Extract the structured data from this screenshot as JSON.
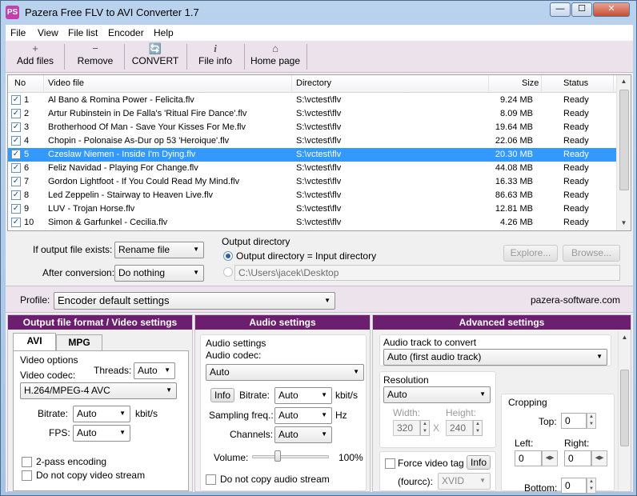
{
  "window": {
    "title": "Pazera Free FLV to AVI Converter 1.7",
    "app_icon": "PS",
    "controls": {
      "minimize": "—",
      "maximize": "☐",
      "close": "✕"
    }
  },
  "menu": [
    "File",
    "View",
    "File list",
    "Encoder",
    "Help"
  ],
  "toolbar": {
    "add": {
      "label": "Add files",
      "icon": "plus-icon",
      "glyph": "+"
    },
    "remove": {
      "label": "Remove",
      "icon": "minus-icon",
      "glyph": "−"
    },
    "convert": {
      "label": "CONVERT",
      "icon": "convert-icon",
      "glyph": "🔄"
    },
    "fileinfo": {
      "label": "File info",
      "icon": "info-icon",
      "glyph": "i"
    },
    "home": {
      "label": "Home page",
      "icon": "home-icon",
      "glyph": "⌂"
    }
  },
  "file_list": {
    "columns": [
      "No",
      "Video file",
      "Directory",
      "Size",
      "Status"
    ],
    "rows": [
      {
        "no": "1",
        "file": "Al Bano & Romina Power - Felicita.flv",
        "dir": "S:\\vctest\\flv",
        "size": "9.24 MB",
        "status": "Ready"
      },
      {
        "no": "2",
        "file": "Artur Rubinstein in De Falla's 'Ritual Fire Dance'.flv",
        "dir": "S:\\vctest\\flv",
        "size": "8.09 MB",
        "status": "Ready"
      },
      {
        "no": "3",
        "file": "Brotherhood Of Man - Save Your Kisses For Me.flv",
        "dir": "S:\\vctest\\flv",
        "size": "19.64 MB",
        "status": "Ready"
      },
      {
        "no": "4",
        "file": "Chopin - Polonaise As-Dur op 53 'Heroique'.flv",
        "dir": "S:\\vctest\\flv",
        "size": "22.06 MB",
        "status": "Ready"
      },
      {
        "no": "5",
        "file": "Czeslaw Niemen - Inside I'm Dying.flv",
        "dir": "S:\\vctest\\flv",
        "size": "20.30 MB",
        "status": "Ready"
      },
      {
        "no": "6",
        "file": "Feliz Navidad - Playing For Change.flv",
        "dir": "S:\\vctest\\flv",
        "size": "44.08 MB",
        "status": "Ready"
      },
      {
        "no": "7",
        "file": "Gordon Lightfoot - If You Could Read My Mind.flv",
        "dir": "S:\\vctest\\flv",
        "size": "16.33 MB",
        "status": "Ready"
      },
      {
        "no": "8",
        "file": "Led Zeppelin - Stairway to Heaven Live.flv",
        "dir": "S:\\vctest\\flv",
        "size": "86.63 MB",
        "status": "Ready"
      },
      {
        "no": "9",
        "file": "LUV - Trojan Horse.flv",
        "dir": "S:\\vctest\\flv",
        "size": "12.81 MB",
        "status": "Ready"
      },
      {
        "no": "10",
        "file": "Simon & Garfunkel - Cecilia.flv",
        "dir": "S:\\vctest\\flv",
        "size": "4.26 MB",
        "status": "Ready"
      }
    ],
    "selected_row": "5",
    "check_glyph": "✓"
  },
  "output": {
    "if_exists_label": "If output file exists:",
    "if_exists_value": "Rename file",
    "after_conversion_label": "After conversion:",
    "after_conversion_value": "Do nothing",
    "dir_group_label": "Output directory",
    "radio_same_label": "Output directory = Input directory",
    "custom_path": "C:\\Users\\jacek\\Desktop",
    "explore_button": "Explore...",
    "browse_button": "Browse..."
  },
  "profile": {
    "label": "Profile:",
    "value": "Encoder default settings",
    "website": "pazera-software.com"
  },
  "video": {
    "header": "Output file format / Video settings",
    "tabs": [
      "AVI",
      "MPG"
    ],
    "group_label": "Video options",
    "codec_label": "Video codec:",
    "threads_label": "Threads:",
    "threads_value": "Auto",
    "codec_value": "H.264/MPEG-4 AVC",
    "bitrate_label": "Bitrate:",
    "bitrate_value": "Auto",
    "bitrate_unit": "kbit/s",
    "fps_label": "FPS:",
    "fps_value": "Auto",
    "two_pass_label": "2-pass encoding",
    "no_copy_label": "Do not copy video stream"
  },
  "audio": {
    "header": "Audio settings",
    "group_label": "Audio settings",
    "codec_label": "Audio codec:",
    "codec_value": "Auto",
    "info_button": "Info",
    "bitrate_label": "Bitrate:",
    "bitrate_value": "Auto",
    "bitrate_unit": "kbit/s",
    "sampling_label": "Sampling freq.:",
    "sampling_value": "Auto",
    "sampling_unit": "Hz",
    "channels_label": "Channels:",
    "channels_value": "Auto",
    "volume_label": "Volume:",
    "volume_value": "100%",
    "volume_level": 0.33,
    "no_copy_label": "Do not copy audio stream"
  },
  "advanced": {
    "header": "Advanced settings",
    "track_label": "Audio track to convert",
    "track_value": "Auto (first audio track)",
    "resolution_label": "Resolution",
    "resolution_value": "Auto",
    "width_label": "Width:",
    "width_value": "320",
    "height_label": "Height:",
    "height_value": "240",
    "x_sep": "X",
    "cropping_label": "Cropping",
    "top_label": "Top:",
    "top_value": "0",
    "left_label": "Left:",
    "left_value": "0",
    "right_label": "Right:",
    "right_value": "0",
    "bottom_label": "Bottom:",
    "bottom_value": "0",
    "force_tag_label": "Force video tag",
    "info_button": "Info",
    "fourcc_label": "(fourcc):",
    "fourcc_value": "XVID"
  },
  "arrows": {
    "up": "▲",
    "down": "▼",
    "left": "◀",
    "right": "▶"
  }
}
